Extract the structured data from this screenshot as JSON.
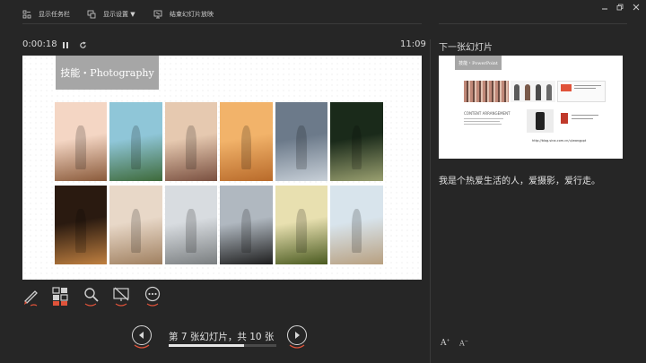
{
  "toolbar": {
    "show_taskbar": "显示任务栏",
    "display_settings": "显示设置 ▼",
    "end_show": "结束幻灯片放映"
  },
  "window": {
    "minimize": "minimize-icon",
    "restore": "restore-icon",
    "close": "close-icon"
  },
  "presenter": {
    "elapsed": "0:00:18",
    "clock": "11:09",
    "next_slide_label": "下一张幻灯片"
  },
  "slide": {
    "title": "技能・Photography",
    "photos": [
      {
        "desc": "child-portrait",
        "c1": "#f4d6c4",
        "c2": "#8a5a3a"
      },
      {
        "desc": "lake-trees",
        "c1": "#8fc6d8",
        "c2": "#3e6a3a"
      },
      {
        "desc": "smiling-woman",
        "c1": "#e6c9b0",
        "c2": "#7a5040"
      },
      {
        "desc": "sunset",
        "c1": "#f2b36a",
        "c2": "#b86a2a"
      },
      {
        "desc": "woman-on-steps",
        "c1": "#6c7a8a",
        "c2": "#c8d0d8"
      },
      {
        "desc": "street-shade",
        "c1": "#1a2a1a",
        "c2": "#9aa070"
      },
      {
        "desc": "night-street",
        "c1": "#2a1a10",
        "c2": "#c08040"
      },
      {
        "desc": "woman-railing",
        "c1": "#e8d8c8",
        "c2": "#a08060"
      },
      {
        "desc": "bridge-tracks",
        "c1": "#d8dce0",
        "c2": "#7a7e80"
      },
      {
        "desc": "woman-black-dress",
        "c1": "#b0b8c0",
        "c2": "#1e1e1e"
      },
      {
        "desc": "grass-sunlight",
        "c1": "#e8e0b0",
        "c2": "#4a5a20"
      },
      {
        "desc": "woman-beach",
        "c1": "#d8e4ec",
        "c2": "#b8a080"
      }
    ]
  },
  "next_slide": {
    "title": "技能・PowerPoint",
    "caption": "CONTENT ARRANGEMENT",
    "url": "http://blog.sina.com.cn/u/wangppt"
  },
  "notes": "我是个热爱生活的人，爱摄影，爱行走。",
  "tools": {
    "pen": "pen-icon",
    "slides": "grid-icon",
    "zoom": "magnifier-icon",
    "black": "black-screen-icon",
    "more": "more-icon"
  },
  "navigation": {
    "slide_count": "第 7 张幻灯片，共 10 张",
    "progress": 0.7
  },
  "font_controls": {
    "increase": "A",
    "decrease": "A"
  },
  "colors": {
    "accent": "#e0533a",
    "background": "#262626",
    "title_bar": "#a6a6a6"
  }
}
